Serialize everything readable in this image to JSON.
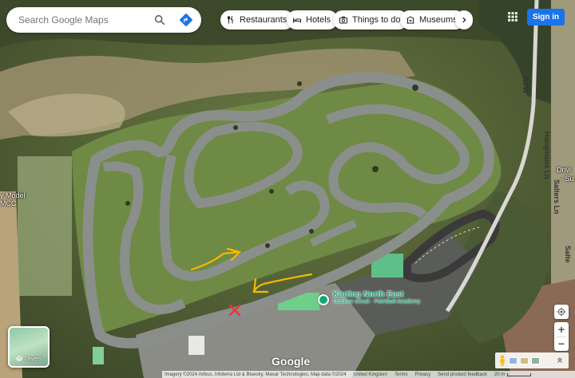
{
  "search": {
    "placeholder": "Search Google Maps"
  },
  "chips": [
    {
      "label": "Restaurants",
      "icon": "fork-knife-icon"
    },
    {
      "label": "Hotels",
      "icon": "bed-icon"
    },
    {
      "label": "Things to do",
      "icon": "camera-icon"
    },
    {
      "label": "Museums",
      "icon": "museum-icon"
    }
  ],
  "header": {
    "signin_label": "Sign in"
  },
  "map": {
    "place_name": "Karting North East",
    "place_sub": "Outdoor circuit · Paintball Academy",
    "left_label": "y Model\nMCC",
    "road_w2w": "W2W",
    "road_hangmans": "Hangmans Ln",
    "road_salters": "Salters Ln",
    "road_salte": "Salte",
    "right_label": "Drivi",
    "right_label2": "- Su"
  },
  "layers": {
    "label": "Layers"
  },
  "logo": {
    "text": "Google"
  },
  "footer": {
    "imagery": "Imagery ©2024 Airbus, Infoterra Ltd & Bluesky, Maxar Technologies, Map data ©2024",
    "region": "United Kingdom",
    "terms": "Terms",
    "privacy": "Privacy",
    "feedback": "Send product feedback",
    "scale": "20 m"
  },
  "colors": {
    "accent": "#1a73e8",
    "place": "#17a67a",
    "annotation": "#f5b800",
    "marker_x": "#e53935"
  }
}
